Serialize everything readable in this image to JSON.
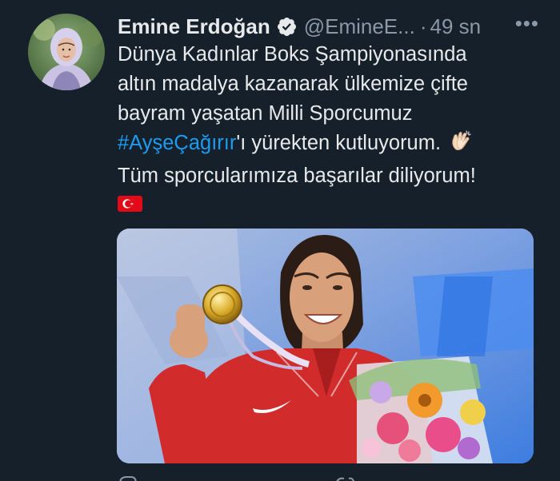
{
  "author": {
    "name": "Emine Erdoğan",
    "handle": "@EmineE...",
    "separator": "·",
    "time": "49 sn",
    "verified": true,
    "avatar_icon": "profile-photo"
  },
  "more_label": "•••",
  "tweet": {
    "line1": "Dünya Kadınlar Boks Şampiyonasında",
    "line2": "altın madalya kazanarak ülkemize çifte",
    "line3": "bayram yaşatan Milli Sporcumuz",
    "hashtag": "#AyşeÇağırır",
    "line4_rest": "'ı yürekten kutluyorum.",
    "line5": "Tüm sporcularımıza başarılar diliyorum!",
    "emoji_clap": "clapping-hands-icon",
    "emoji_flag": "turkey-flag-icon"
  },
  "colors": {
    "background": "#15202b",
    "text": "#e7e9ea",
    "secondary": "#8b98a5",
    "link": "#1d9bf0",
    "verified_badge": "#e7e9ea"
  },
  "media": {
    "description_icon": "photo-boxer-with-gold-medal-and-flowers"
  }
}
